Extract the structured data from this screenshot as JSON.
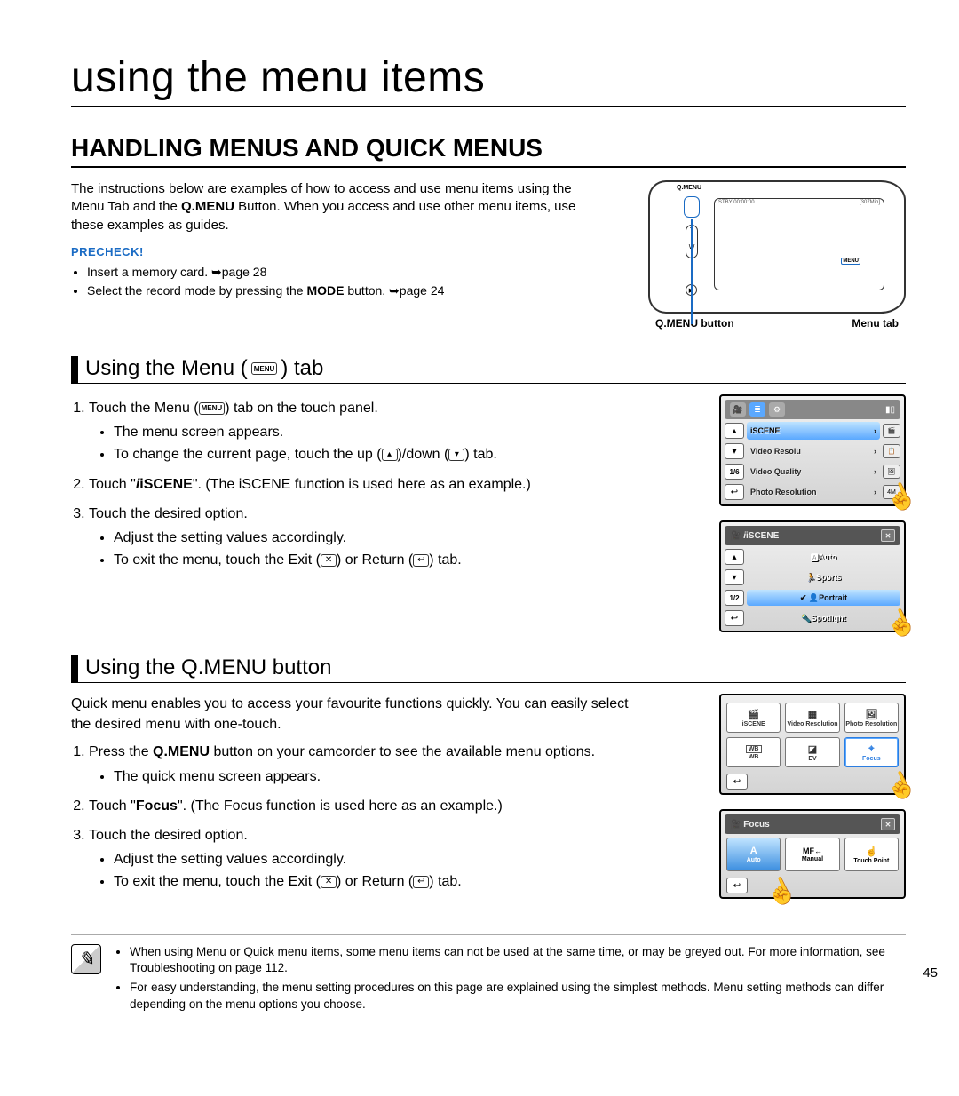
{
  "pageNumber": "45",
  "title": "using the menu items",
  "heading": "HANDLING MENUS AND QUICK MENUS",
  "intro_a": "The instructions below are examples of how to access and use menu items using the Menu Tab and the ",
  "intro_bold": "Q.MENU",
  "intro_b": " Button. When you access and use other menu items, use these examples as guides.",
  "precheck": "PRECHECK!",
  "precheck_items": [
    "Insert a memory card. ➥page 28",
    "Select the record mode by pressing the MODE button. ➥page 24"
  ],
  "device": {
    "qmenuLabelTop": "Q.MENU",
    "zoomT": "T",
    "zoomW": "W",
    "play": "▶",
    "menuTab": "MENU",
    "statusL": "STBY  00:00:00",
    "statusR": "[307Min]",
    "label_qbtn": "Q.MENU button",
    "label_menutab": "Menu tab"
  },
  "sec1": {
    "head_a": "Using the Menu (",
    "head_icon": "MENU",
    "head_b": ") tab",
    "step1_a": "Touch the Menu (",
    "step1_icon": "MENU",
    "step1_b": ") tab on the touch panel.",
    "step1_sub1": "The menu screen appears.",
    "step1_sub2_a": "To change the current page, touch the up (",
    "step1_sub2_b": ")/down (",
    "step1_sub2_c": ") tab.",
    "step2_a": "Touch \"",
    "step2_bold": "iSCENE",
    "step2_b": "\". (The iSCENE function is used here as an example.)",
    "step3": "Touch the desired option.",
    "step3_sub1": "Adjust the setting values accordingly.",
    "step3_sub2_a": "To exit the menu, touch the Exit (",
    "step3_sub2_b": ") or Return (",
    "step3_sub2_c": ") tab."
  },
  "sec2": {
    "head": "Using the Q.MENU button",
    "para": "Quick menu enables you to access your favourite functions quickly. You can easily select the desired menu with one-touch.",
    "step1_a": "Press the ",
    "step1_bold": "Q.MENU",
    "step1_b": " button on your camcorder to see the available menu options.",
    "step1_sub1": "The quick menu screen appears.",
    "step2_a": "Touch \"",
    "step2_bold": "Focus",
    "step2_b": "\". (The Focus function is used here as an example.)",
    "step3": "Touch the desired option.",
    "step3_sub1": "Adjust the setting values accordingly.",
    "step3_sub2_a": "To exit the menu, touch the Exit (",
    "step3_sub2_b": ") or Return (",
    "step3_sub2_c": ") tab."
  },
  "notes": [
    "When using Menu or Quick menu items, some menu items can not be used at the same time, or may be greyed out. For more information, see Troubleshooting on page 112.",
    "For easy understanding, the menu setting procedures on this page are explained using the simplest methods. Menu setting methods can differ depending on the menu options you choose."
  ],
  "panel1": {
    "items": [
      "iSCENE",
      "Video Resolu",
      "Video Quality",
      "Photo Resolution"
    ],
    "badges": [
      "🎬",
      "📋",
      "🖼",
      "4M"
    ],
    "sideCounter": "1/6"
  },
  "panel2": {
    "title": "iSCENE",
    "items": [
      "Auto",
      "Sports",
      "Portrait",
      "Spotlight"
    ],
    "sideCounter": "1/2"
  },
  "qmenuGrid": {
    "cells": [
      "iSCENE",
      "Video Resolution",
      "Photo Resolution",
      "WB",
      "EV",
      "Focus"
    ]
  },
  "focusPanel": {
    "title": "Focus",
    "items": [
      "Auto",
      "Manual",
      "Touch Point"
    ]
  }
}
